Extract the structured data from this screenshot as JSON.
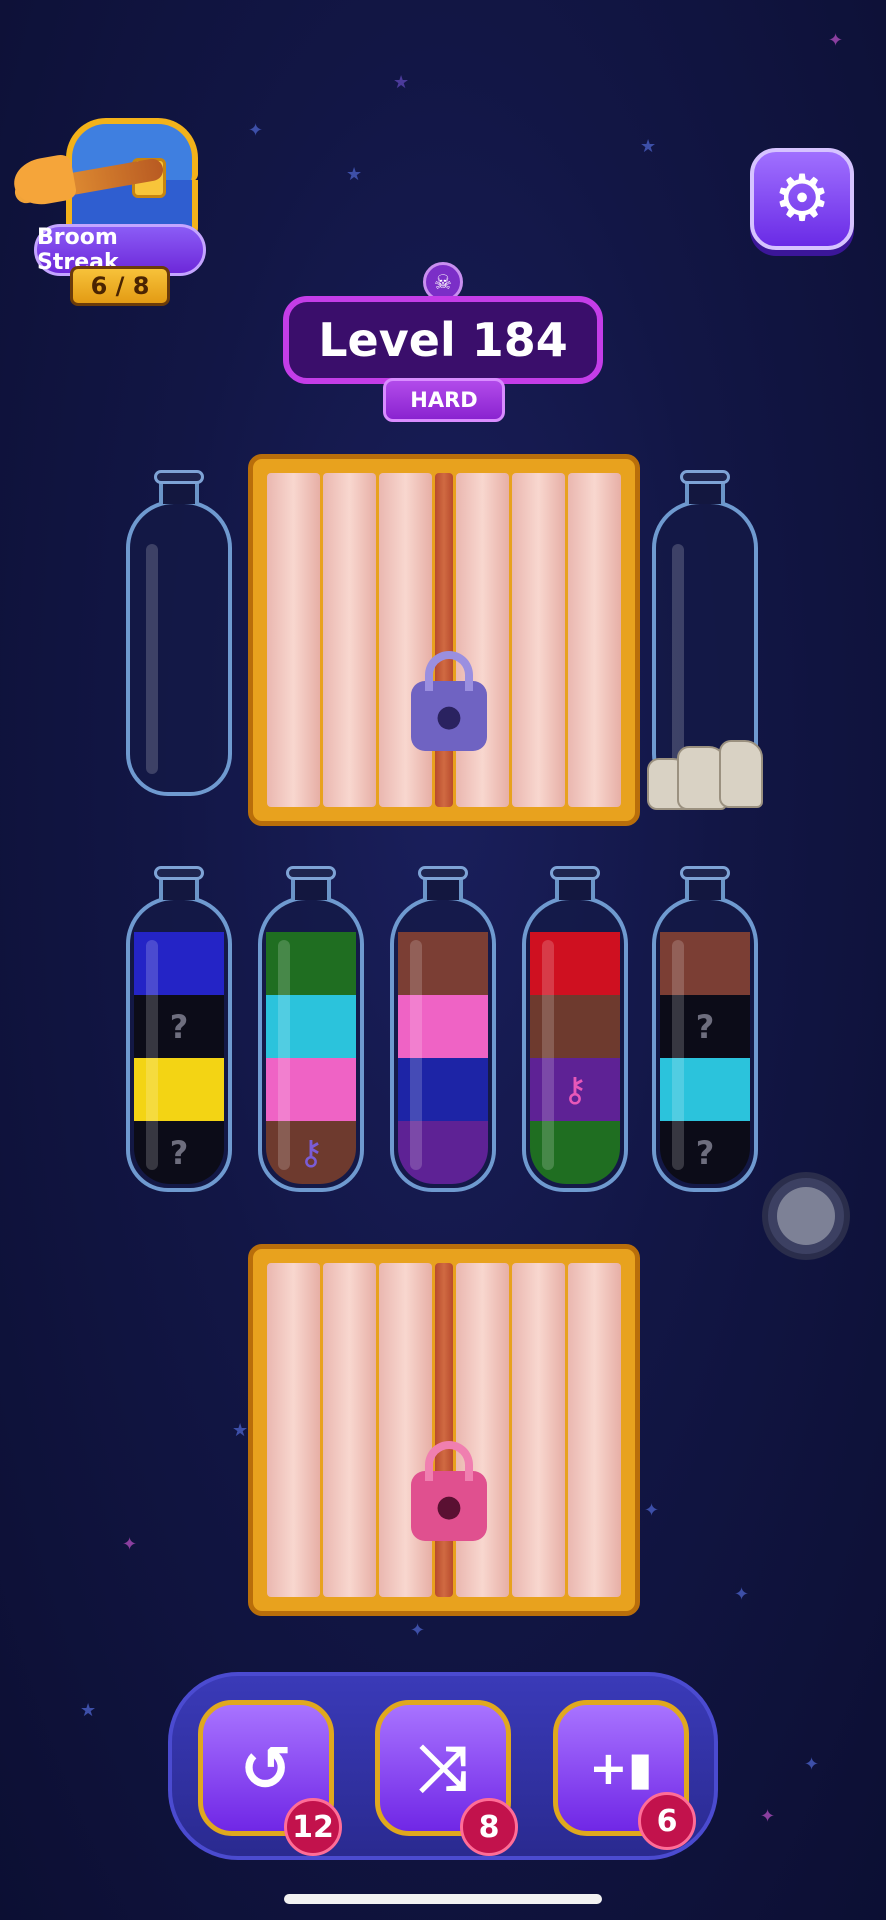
{
  "streak": {
    "label": "Broom Streak",
    "count": "6 / 8"
  },
  "level": {
    "title": "Level 184",
    "difficulty": "HARD"
  },
  "icons": {
    "skull": "☠",
    "settings": "⚙",
    "undo": "↺",
    "shuffle": "⤨",
    "add_bottle": "+▮",
    "key": "⚷",
    "lock": "●"
  },
  "bottles_top": [
    {
      "id": "empty-left",
      "layers": []
    },
    {
      "id": "rocks-right",
      "layers": [],
      "rocks": true
    }
  ],
  "bottles_row": [
    {
      "layers": [
        {
          "color": "#2424c6"
        },
        {
          "color": "#0c0c18",
          "hidden": true,
          "mark": "?"
        },
        {
          "color": "#f3d414"
        },
        {
          "color": "#0c0c18",
          "hidden": true,
          "mark": "?"
        }
      ]
    },
    {
      "layers": [
        {
          "color": "#1f6e21"
        },
        {
          "color": "#2bc3dc"
        },
        {
          "color": "#ef63c5"
        },
        {
          "color": "#6e3a2e",
          "key": true,
          "key_color": "#7a5cd6"
        }
      ]
    },
    {
      "layers": [
        {
          "color": "#7b3e34"
        },
        {
          "color": "#ef63c5"
        },
        {
          "color": "#1d24a6"
        },
        {
          "color": "#5e2295"
        }
      ]
    },
    {
      "layers": [
        {
          "color": "#cf1020"
        },
        {
          "color": "#6e3a2e"
        },
        {
          "color": "#5e2295",
          "key": true,
          "key_color": "#e858b8"
        },
        {
          "color": "#1f6e21"
        }
      ]
    },
    {
      "layers": [
        {
          "color": "#7b3e34"
        },
        {
          "color": "#0c0c18",
          "hidden": true,
          "mark": "?"
        },
        {
          "color": "#2bc3dc"
        },
        {
          "color": "#0c0c18",
          "hidden": true,
          "mark": "?"
        }
      ]
    }
  ],
  "crates": [
    {
      "id": "crate-top",
      "lock_color": "#6f63c2",
      "shackle_color": "#9a8fe0"
    },
    {
      "id": "crate-bottom",
      "lock_color": "#e0508f",
      "shackle_color": "#f07fb0"
    }
  ],
  "powerups": [
    {
      "name": "undo",
      "icon": "↺",
      "count": "12"
    },
    {
      "name": "shuffle",
      "icon": "⤨",
      "count": "8"
    },
    {
      "name": "add-bottle",
      "icon": "+▮",
      "count": "6"
    }
  ]
}
